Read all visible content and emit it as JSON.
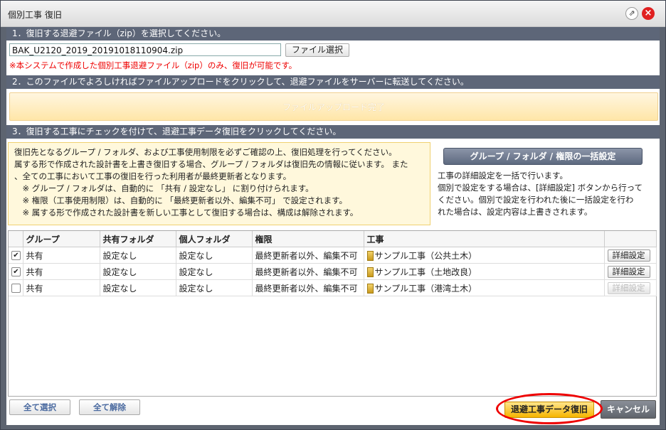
{
  "window": {
    "title": "個別工事 復旧",
    "popout_icon": "popout-icon",
    "close_icon": "close-icon"
  },
  "section1": {
    "header": "1．復旧する退避ファイル（zip）を選択してください。",
    "file_value": "BAK_U2120_2019_20191018110904.zip",
    "file_button": "ファイル選択",
    "note": "※本システムで作成した個別工事退避ファイル（zip）のみ、復旧が可能です。"
  },
  "section2": {
    "header": "2．このファイルでよろしければファイルアップロードをクリックして、退避ファイルをサーバーに転送してください。",
    "upload_button": "ファイルアップロード完了"
  },
  "section3": {
    "header": "3．復旧する工事にチェックを付けて、退避工事データ復旧をクリックしてください。",
    "info_lines": [
      "復旧先となるグループ / フォルダ、および工事使用制限を必ずご確認の上、復旧処理を行ってください。",
      "属する形で作成された設計書を上書き復旧する場合、グループ / フォルダは復旧先の情報に従います。 また",
      "、全ての工事において工事の復旧を行った利用者が最終更新者となります。",
      "　※ グループ / フォルダは、自動的に 「共有 / 設定なし」 に割り付けられます。",
      "　※ 権限（工事使用制限）は、自動的に 「最終更新者以外、編集不可」 で設定されます。",
      "　※ 属する形で作成された設計書を新しい工事として復旧する場合は、構成は解除されます。"
    ],
    "bulk_button": "グループ / フォルダ / 権限の一括設定",
    "bulk_desc": [
      "工事の詳細設定を一括で行います。",
      "個別で設定をする場合は、[詳細設定] ボタンから行って",
      "ください。個別で設定を行われた後に一括設定を行わ",
      "れた場合は、設定内容は上書きされます。"
    ]
  },
  "table": {
    "columns": [
      "グループ",
      "共有フォルダ",
      "個人フォルダ",
      "権限",
      "工事",
      ""
    ],
    "rows": [
      {
        "checked": "✔",
        "group": "共有",
        "shared": "設定なし",
        "personal": "設定なし",
        "perm": "最終更新者以外、編集不可",
        "project": "サンプル工事（公共土木）",
        "detail": "詳細設定"
      },
      {
        "checked": "✔",
        "group": "共有",
        "shared": "設定なし",
        "personal": "設定なし",
        "perm": "最終更新者以外、編集不可",
        "project": "サンプル工事（土地改良）",
        "detail": "詳細設定"
      },
      {
        "checked": "",
        "group": "共有",
        "shared": "設定なし",
        "personal": "設定なし",
        "perm": "最終更新者以外、編集不可",
        "project": "サンプル工事（港湾土木）",
        "detail": "詳細設定"
      }
    ]
  },
  "footer": {
    "select_all": "全て選択",
    "deselect_all": "全て解除",
    "restore": "退避工事データ復旧",
    "cancel": "キャンセル"
  },
  "colors": {
    "section_header": "#5d6678",
    "restore_accent": "#f6b500",
    "highlight_ellipse": "#e00000"
  }
}
